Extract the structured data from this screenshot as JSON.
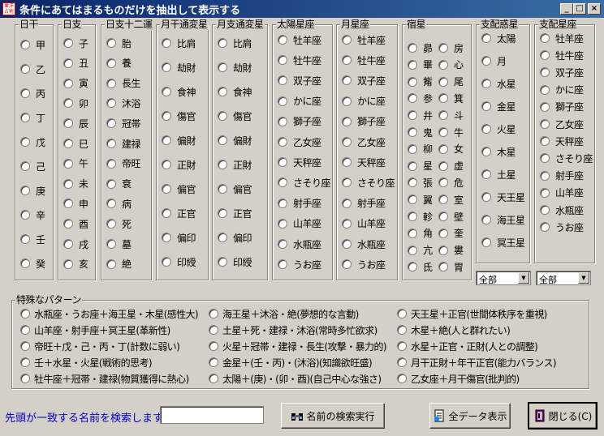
{
  "window": {
    "title": "条件にあてはまるものだけを抽出して表示する",
    "icon_text": "東洋占術"
  },
  "groups": [
    {
      "title": "日干",
      "items": [
        "甲",
        "乙",
        "丙",
        "丁",
        "戊",
        "己",
        "庚",
        "辛",
        "壬",
        "癸"
      ]
    },
    {
      "title": "日支",
      "items": [
        "子",
        "丑",
        "寅",
        "卯",
        "辰",
        "巳",
        "午",
        "未",
        "申",
        "酉",
        "戌",
        "亥"
      ]
    },
    {
      "title": "日支十二運",
      "items": [
        "胎",
        "養",
        "長生",
        "沐浴",
        "冠帯",
        "建禄",
        "帝旺",
        "衰",
        "病",
        "死",
        "墓",
        "絶"
      ]
    },
    {
      "title": "月干通変星",
      "items": [
        "比肩",
        "劫財",
        "食神",
        "傷官",
        "偏財",
        "正財",
        "偏官",
        "正官",
        "偏印",
        "印綬"
      ]
    },
    {
      "title": "月支通変星",
      "items": [
        "比肩",
        "劫財",
        "食神",
        "傷官",
        "偏財",
        "正財",
        "偏官",
        "正官",
        "偏印",
        "印綬"
      ]
    },
    {
      "title": "太陽星座",
      "items": [
        "牡羊座",
        "牡牛座",
        "双子座",
        "かに座",
        "獅子座",
        "乙女座",
        "天秤座",
        "さそり座",
        "射手座",
        "山羊座",
        "水瓶座",
        "うお座"
      ]
    },
    {
      "title": "月星座",
      "items": [
        "牡羊座",
        "牡牛座",
        "双子座",
        "かに座",
        "獅子座",
        "乙女座",
        "天秤座",
        "さそり座",
        "射手座",
        "山羊座",
        "水瓶座",
        "うお座"
      ]
    },
    {
      "title": "宿星",
      "left": [
        "昴",
        "畢",
        "觜",
        "参",
        "井",
        "鬼",
        "柳",
        "星",
        "張",
        "翼",
        "軫",
        "角",
        "亢",
        "氐"
      ],
      "right": [
        "房",
        "心",
        "尾",
        "箕",
        "斗",
        "牛",
        "女",
        "虚",
        "危",
        "室",
        "壁",
        "奎",
        "婁",
        "胃"
      ]
    },
    {
      "title": "支配惑星",
      "items": [
        "太陽",
        "月",
        "水星",
        "金星",
        "火星",
        "木星",
        "土星",
        "天王星",
        "海王星",
        "冥王星"
      ],
      "combo": "全部"
    },
    {
      "title": "支配星座",
      "items": [
        "牡羊座",
        "牡牛座",
        "双子座",
        "かに座",
        "獅子座",
        "乙女座",
        "天秤座",
        "さそり座",
        "射手座",
        "山羊座",
        "水瓶座",
        "うお座"
      ],
      "combo": "全部"
    }
  ],
  "patterns": {
    "title": "特殊なパターン",
    "items": [
      "水瓶座・うお座＋海王星・木星(感性大)",
      "山羊座・射手座＋冥王星(革新性)",
      "帝旺＋戊・己・丙・丁(計数に弱い)",
      "壬＋水星・火星(戦術的思考)",
      "牡牛座＋冠帯・建禄(物質獲得に熱心)",
      "海王星＋沐浴・絶(夢想的な言動)",
      "土星＋死・建禄・沐浴(常時多忙欲求)",
      "火星＋冠帯・建禄・長生(攻撃・暴力的)",
      "金星＋(壬・丙)・(沐浴)(知識欲旺盛)",
      "太陽＋(庚)・(卯・酉)(自己中心な強さ)",
      "天王星＋正官(世間体秩序を重視)",
      "木星＋絶(人と群れたい)",
      "水星＋正官・正財(人との調整)",
      "月干正財＋年干正官(能力バランス)",
      "乙女座＋月干傷官(批判的)"
    ]
  },
  "search": {
    "label": "先頭が一致する名前を検索します",
    "value": ""
  },
  "buttons": {
    "search": "名前の検索実行",
    "all": "全データ表示",
    "close": "閉じる(C)"
  }
}
